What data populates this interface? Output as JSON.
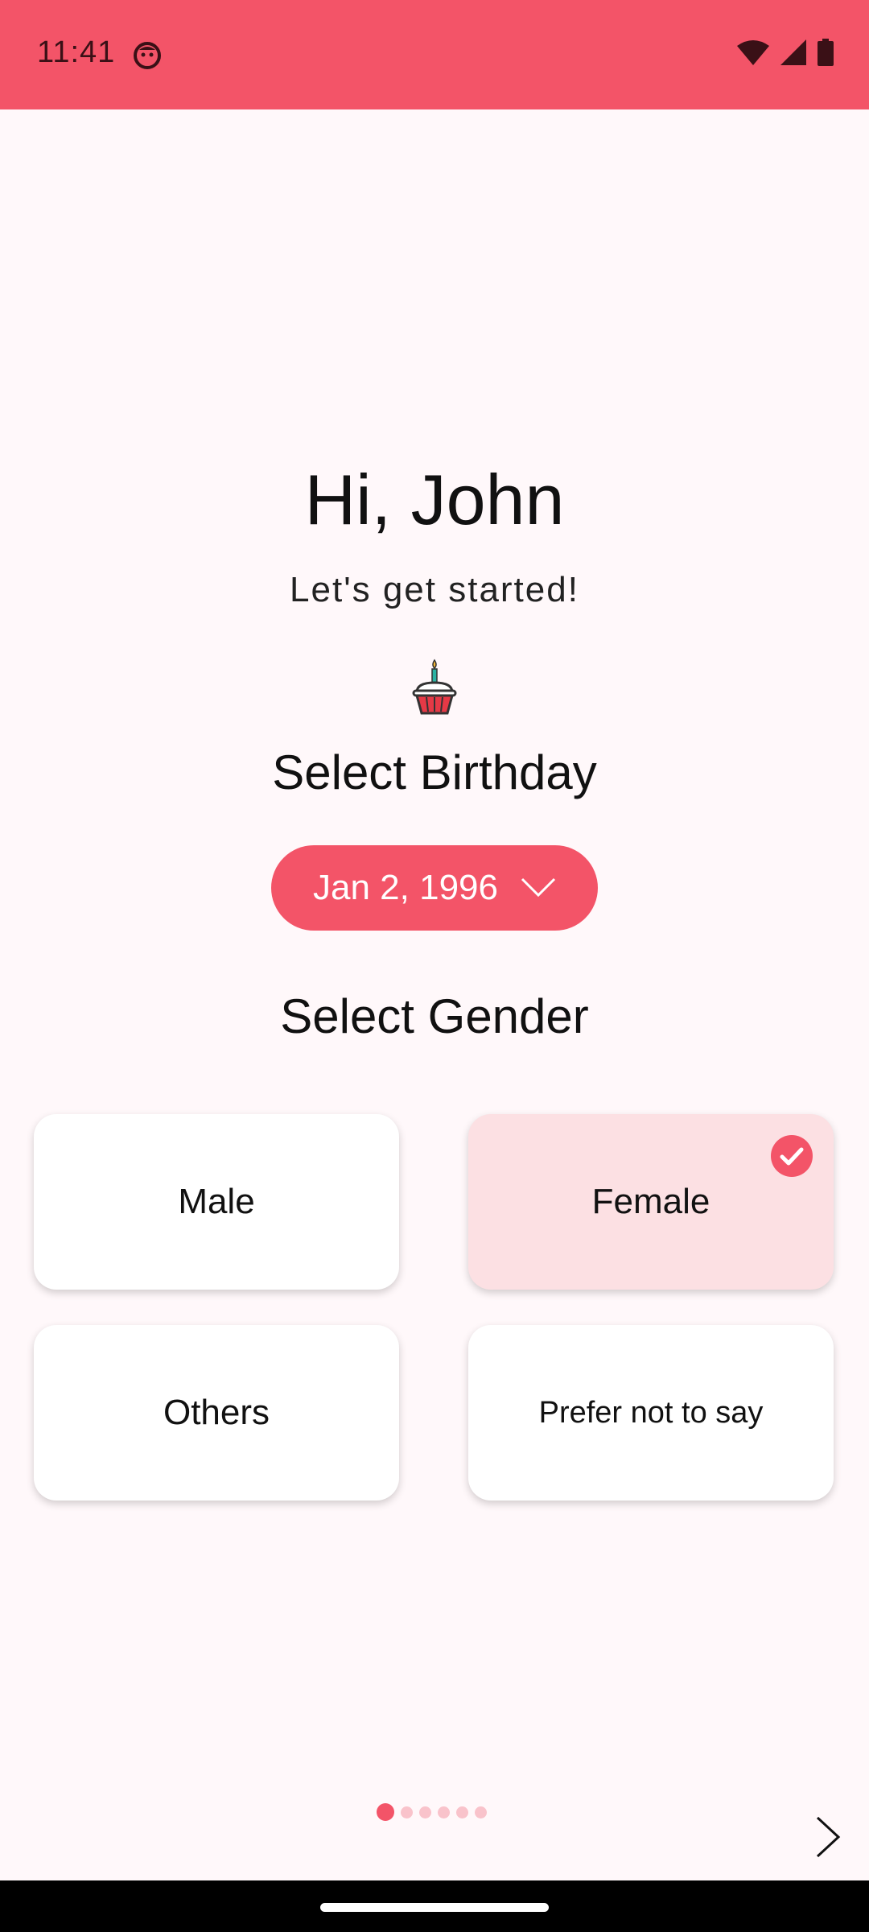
{
  "status_bar": {
    "time": "11:41",
    "background": "#F35468"
  },
  "header": {
    "greeting": "Hi, John",
    "subtitle": "Let's get started!"
  },
  "birthday": {
    "icon": "cupcake-icon",
    "title": "Select Birthday",
    "selected_date": "Jan 2, 1996"
  },
  "gender": {
    "title": "Select Gender",
    "options": [
      {
        "label": "Male",
        "selected": false
      },
      {
        "label": "Female",
        "selected": true
      },
      {
        "label": "Others",
        "selected": false
      },
      {
        "label": "Prefer not to say",
        "selected": false
      }
    ]
  },
  "pager": {
    "total_pages": 6,
    "current_page": 1
  },
  "colors": {
    "accent": "#F35468",
    "selected_card": "#FCE0E3",
    "background": "#FFF8FA"
  }
}
